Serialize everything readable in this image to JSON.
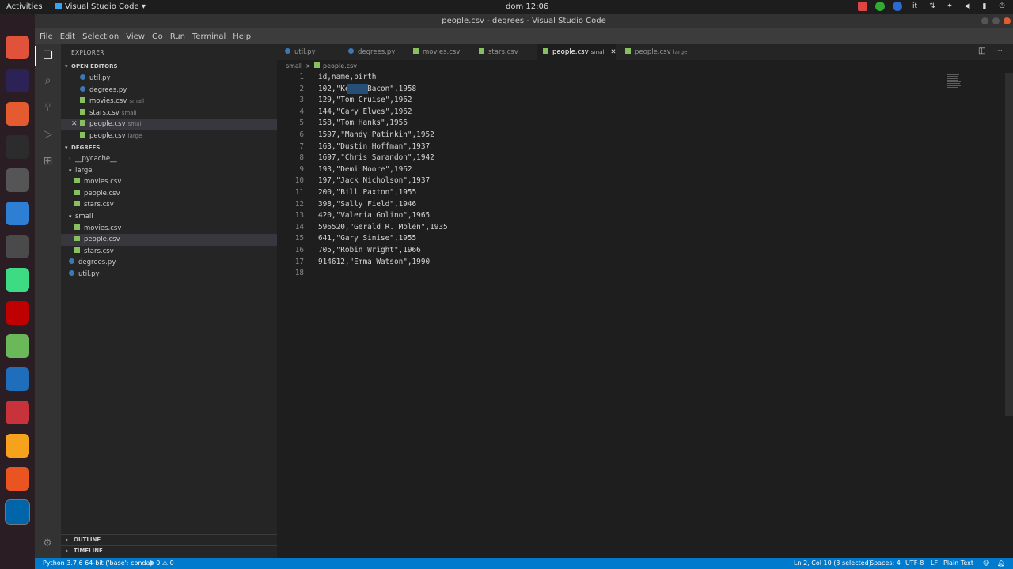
{
  "topbar": {
    "activities": "Activities",
    "app_name": "Visual Studio Code",
    "app_caret": "▾",
    "clock": "dom 12:06",
    "lang": "it",
    "tray_icons": [
      "camera-icon",
      "chrome-icon",
      "hp-icon",
      "language-icon",
      "network-icon",
      "settings-icon",
      "volume-icon",
      "battery-icon",
      "power-icon"
    ]
  },
  "window": {
    "title": "people.csv - degrees - Visual Studio Code"
  },
  "dock": {
    "apps": [
      {
        "name": "ubuntu-software-icon",
        "color": "#e0533a"
      },
      {
        "name": "eclipse-icon",
        "color": "#2c2255"
      },
      {
        "name": "text-editor-icon",
        "color": "#e35b2e"
      },
      {
        "name": "terminal-icon",
        "color": "#2c2c2c"
      },
      {
        "name": "tools-icon",
        "color": "#555"
      },
      {
        "name": "thunderbird-icon",
        "color": "#2d7fd3"
      },
      {
        "name": "texmaker-icon",
        "color": "#4a4a4a"
      },
      {
        "name": "android-studio-icon",
        "color": "#3ddc84"
      },
      {
        "name": "filezilla-icon",
        "color": "#bf0000"
      },
      {
        "name": "nqq-icon",
        "color": "#6bb85a"
      },
      {
        "name": "vscode-icon",
        "color": "#1e6ebc"
      },
      {
        "name": "settings-gear-icon",
        "color": "#c8333b"
      },
      {
        "name": "scratch-icon",
        "color": "#f6a21c"
      },
      {
        "name": "ubuntu-icon",
        "color": "#e95420"
      },
      {
        "name": "vscode-active-icon",
        "color": "#0065a9"
      },
      {
        "name": "apps-grid-icon",
        "color": "#2a1e24"
      }
    ]
  },
  "menubar": {
    "items": [
      "File",
      "Edit",
      "Selection",
      "View",
      "Go",
      "Run",
      "Terminal",
      "Help"
    ]
  },
  "sidebar": {
    "title": "EXPLORER",
    "open_editors_label": "OPEN EDITORS",
    "open_editors": [
      {
        "label": "util.py",
        "type": "py",
        "desc": ""
      },
      {
        "label": "degrees.py",
        "type": "py",
        "desc": ""
      },
      {
        "label": "movies.csv",
        "type": "csv",
        "desc": "small"
      },
      {
        "label": "stars.csv",
        "type": "csv",
        "desc": "small"
      },
      {
        "label": "people.csv",
        "type": "csv",
        "desc": "small"
      },
      {
        "label": "people.csv",
        "type": "csv",
        "desc": "large"
      }
    ],
    "folder_label": "DEGREES",
    "tree": [
      {
        "label": "__pycache__",
        "kind": "folder",
        "depth": 1,
        "open": false
      },
      {
        "label": "large",
        "kind": "folder",
        "depth": 1,
        "open": true
      },
      {
        "label": "movies.csv",
        "kind": "csv",
        "depth": 2
      },
      {
        "label": "people.csv",
        "kind": "csv",
        "depth": 2
      },
      {
        "label": "stars.csv",
        "kind": "csv",
        "depth": 2
      },
      {
        "label": "small",
        "kind": "folder",
        "depth": 1,
        "open": true
      },
      {
        "label": "movies.csv",
        "kind": "csv",
        "depth": 2
      },
      {
        "label": "people.csv",
        "kind": "csv",
        "depth": 2
      },
      {
        "label": "stars.csv",
        "kind": "csv",
        "depth": 2
      },
      {
        "label": "degrees.py",
        "kind": "py",
        "depth": 1
      },
      {
        "label": "util.py",
        "kind": "py",
        "depth": 1
      }
    ],
    "outline_label": "OUTLINE",
    "timeline_label": "TIMELINE"
  },
  "tabs": [
    {
      "label": "util.py",
      "type": "py",
      "desc": ""
    },
    {
      "label": "degrees.py",
      "type": "py",
      "desc": ""
    },
    {
      "label": "movies.csv",
      "type": "csv",
      "desc": ""
    },
    {
      "label": "stars.csv",
      "type": "csv",
      "desc": ""
    },
    {
      "label": "people.csv",
      "type": "csv",
      "desc": "small"
    },
    {
      "label": "people.csv",
      "type": "csv",
      "desc": "large"
    }
  ],
  "breadcrumb": {
    "folder": "small",
    "sep": ">",
    "file": "people.csv"
  },
  "editor": {
    "lines": [
      "id,name,birth",
      "102,\"Kevin Bacon\",1958",
      "129,\"Tom Cruise\",1962",
      "144,\"Cary Elwes\",1962",
      "158,\"Tom Hanks\",1956",
      "1597,\"Mandy Patinkin\",1952",
      "163,\"Dustin Hoffman\",1937",
      "1697,\"Chris Sarandon\",1942",
      "193,\"Demi Moore\",1962",
      "197,\"Jack Nicholson\",1937",
      "200,\"Bill Paxton\",1955",
      "398,\"Sally Field\",1946",
      "420,\"Valeria Golino\",1965",
      "596520,\"Gerald R. Molen\",1935",
      "641,\"Gary Sinise\",1955",
      "705,\"Robin Wright\",1966",
      "914612,\"Emma Watson\",1990",
      ""
    ],
    "selected_text": "evin"
  },
  "statusbar": {
    "python": "Python 3.7.6 64-bit ('base': conda)",
    "problems": "⊗ 0 ⚠ 0",
    "cursor": "Ln 2, Col 10 (3 selected)",
    "spaces": "Spaces: 4",
    "encoding": "UTF-8",
    "eol": "LF",
    "language": "Plain Text"
  }
}
